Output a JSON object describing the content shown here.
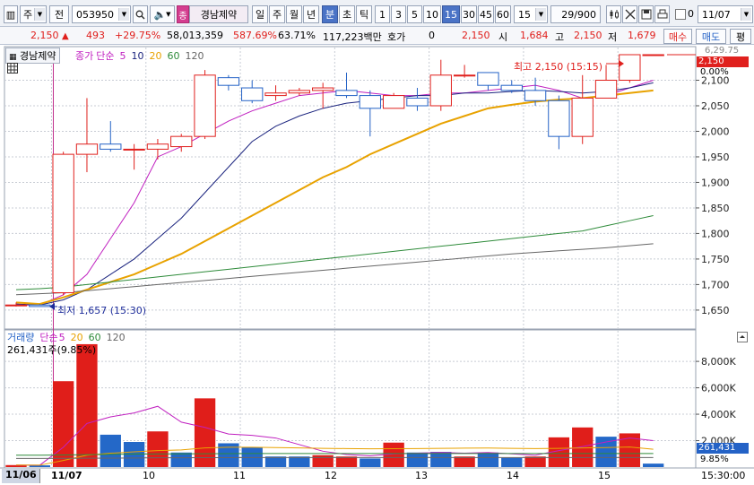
{
  "toolbar": {
    "market": "주",
    "all_label": "전",
    "code": "053950",
    "name_badge": "종",
    "stock_name": "경남제약",
    "periods": [
      "일",
      "주",
      "월",
      "년",
      "분",
      "초",
      "틱"
    ],
    "selected_period": "분",
    "intervals": [
      "1",
      "3",
      "5",
      "10",
      "15",
      "30",
      "45",
      "60"
    ],
    "selected_interval": "15",
    "interval_value": "15",
    "count": "29/900",
    "checkbox_value": "0",
    "date": "11/07"
  },
  "quote": {
    "price": "2,150",
    "change": "493",
    "change_rate": "+29.75%",
    "volume": "58,013,359",
    "volume_ratio": "587.69%",
    "turnover_rate": "63.71%",
    "amount": "117,223백만",
    "bid_label": "호가",
    "bid_value": "0",
    "bid_price": "2,150",
    "open_label": "시",
    "open": "1,684",
    "high_label": "고",
    "high": "2,150",
    "low_label": "저",
    "low": "1,679",
    "buy_label": "매수",
    "sell_label": "매도",
    "eval_label": "평"
  },
  "colors": {
    "up": "#e0201d",
    "down": "#2462c6",
    "ma5": "#c020c0",
    "ma10": "#1a237e",
    "ma20": "#e8a200",
    "ma60": "#2e8b3a",
    "ma120": "#666666"
  },
  "price_panel": {
    "stock_label": "경남제약",
    "legend": {
      "series": "종가",
      "ma_type": "단순",
      "periods": [
        "5",
        "10",
        "20",
        "60",
        "120"
      ]
    },
    "top_label": "6,29.75",
    "top_pct": "0.00%",
    "current_tag": "2,150",
    "high_annotation": "최고 2,150 (15:15)",
    "low_annotation": "최저 1,657 (15:30)"
  },
  "volume_panel": {
    "legend": {
      "series": "거래량",
      "ma_type": "단순",
      "periods": [
        "5",
        "20",
        "60",
        "120"
      ]
    },
    "value_label": "261,431주(9.85%)",
    "current_tag": "261,431",
    "current_pct": "9.85%"
  },
  "x_axis": {
    "labels": [
      "11/06",
      "11/07",
      "10",
      "11",
      "12",
      "13",
      "14",
      "15"
    ],
    "time": "15:30:00"
  },
  "chart_data": [
    {
      "type": "candlestick",
      "ylim": [
        1620,
        2150
      ],
      "yticks": [
        "1,650",
        "1,700",
        "1,750",
        "1,800",
        "1,850",
        "1,900",
        "1,950",
        "2,000",
        "2,050",
        "2,100"
      ],
      "candles": [
        {
          "o": 1660,
          "h": 1665,
          "l": 1657,
          "c": 1660
        },
        {
          "o": 1660,
          "h": 1662,
          "l": 1657,
          "c": 1657
        },
        {
          "o": 1684,
          "h": 1960,
          "l": 1679,
          "c": 1955
        },
        {
          "o": 1955,
          "h": 2065,
          "l": 1920,
          "c": 1975
        },
        {
          "o": 1975,
          "h": 2020,
          "l": 1960,
          "c": 1965
        },
        {
          "o": 1965,
          "h": 1975,
          "l": 1925,
          "c": 1965
        },
        {
          "o": 1965,
          "h": 1985,
          "l": 1945,
          "c": 1975
        },
        {
          "o": 1970,
          "h": 1995,
          "l": 1960,
          "c": 1990
        },
        {
          "o": 1990,
          "h": 2120,
          "l": 1985,
          "c": 2110
        },
        {
          "o": 2105,
          "h": 2110,
          "l": 2080,
          "c": 2090
        },
        {
          "o": 2085,
          "h": 2100,
          "l": 2055,
          "c": 2060
        },
        {
          "o": 2070,
          "h": 2090,
          "l": 2060,
          "c": 2075
        },
        {
          "o": 2075,
          "h": 2085,
          "l": 2070,
          "c": 2080
        },
        {
          "o": 2080,
          "h": 2095,
          "l": 2045,
          "c": 2085
        },
        {
          "o": 2080,
          "h": 2115,
          "l": 2065,
          "c": 2070
        },
        {
          "o": 2070,
          "h": 2080,
          "l": 1990,
          "c": 2045
        },
        {
          "o": 2045,
          "h": 2075,
          "l": 2045,
          "c": 2070
        },
        {
          "o": 2065,
          "h": 2085,
          "l": 2040,
          "c": 2050
        },
        {
          "o": 2050,
          "h": 2140,
          "l": 2040,
          "c": 2110
        },
        {
          "o": 2110,
          "h": 2130,
          "l": 2105,
          "c": 2110
        },
        {
          "o": 2115,
          "h": 2115,
          "l": 2080,
          "c": 2090
        },
        {
          "o": 2090,
          "h": 2100,
          "l": 2075,
          "c": 2080
        },
        {
          "o": 2080,
          "h": 2105,
          "l": 2050,
          "c": 2060
        },
        {
          "o": 2060,
          "h": 2070,
          "l": 1965,
          "c": 1990
        },
        {
          "o": 1990,
          "h": 2110,
          "l": 1975,
          "c": 2065
        },
        {
          "o": 2065,
          "h": 2130,
          "l": 2065,
          "c": 2100
        },
        {
          "o": 2100,
          "h": 2150,
          "l": 2095,
          "c": 2150
        },
        {
          "o": 2150,
          "h": 2150,
          "l": 2150,
          "c": 2150
        }
      ],
      "series": [
        {
          "name": "5",
          "values": [
            1660,
            1660,
            1680,
            1720,
            1790,
            1860,
            1950,
            1970,
            1995,
            2020,
            2040,
            2055,
            2070,
            2075,
            2080,
            2075,
            2070,
            2070,
            2075,
            2075,
            2080,
            2085,
            2090,
            2080,
            2065,
            2070,
            2085,
            2100
          ]
        },
        {
          "name": "10",
          "values": [
            1662,
            1660,
            1670,
            1690,
            1720,
            1750,
            1790,
            1830,
            1880,
            1930,
            1980,
            2010,
            2030,
            2045,
            2055,
            2060,
            2065,
            2070,
            2070,
            2075,
            2075,
            2078,
            2080,
            2078,
            2075,
            2078,
            2085,
            2095
          ]
        },
        {
          "name": "20",
          "values": [
            1665,
            1662,
            1675,
            1690,
            1705,
            1720,
            1740,
            1760,
            1785,
            1810,
            1835,
            1860,
            1885,
            1910,
            1930,
            1955,
            1975,
            1995,
            2015,
            2030,
            2045,
            2052,
            2058,
            2062,
            2065,
            2070,
            2075,
            2080
          ]
        },
        {
          "name": "60",
          "values": [
            1690,
            1692,
            1695,
            1700,
            1705,
            1710,
            1715,
            1720,
            1725,
            1730,
            1735,
            1740,
            1745,
            1750,
            1755,
            1760,
            1765,
            1770,
            1775,
            1780,
            1785,
            1790,
            1795,
            1800,
            1805,
            1815,
            1825,
            1835
          ]
        },
        {
          "name": "120",
          "values": [
            1680,
            1682,
            1684,
            1688,
            1692,
            1696,
            1700,
            1704,
            1708,
            1712,
            1716,
            1720,
            1724,
            1728,
            1732,
            1736,
            1740,
            1744,
            1748,
            1752,
            1756,
            1760,
            1763,
            1766,
            1769,
            1772,
            1776,
            1780
          ]
        }
      ]
    },
    {
      "type": "bar",
      "ylim": [
        0,
        9500
      ],
      "yticks": [
        "2,000K",
        "4,000K",
        "6,000K",
        "8,000K"
      ],
      "values": [
        150,
        130,
        6500,
        9300,
        2450,
        1900,
        2700,
        1100,
        5200,
        1800,
        1500,
        800,
        800,
        900,
        800,
        650,
        1850,
        1100,
        1150,
        800,
        1100,
        700,
        800,
        2250,
        3000,
        2300,
        2550,
        261
      ],
      "directions": [
        "up",
        "down",
        "up",
        "up",
        "down",
        "down",
        "up",
        "down",
        "up",
        "down",
        "down",
        "down",
        "down",
        "up",
        "up",
        "down",
        "up",
        "down",
        "down",
        "up",
        "down",
        "down",
        "up",
        "up",
        "up",
        "down",
        "up",
        "down"
      ],
      "series": [
        {
          "name": "5",
          "values": [
            150,
            140,
            1500,
            3300,
            3800,
            4100,
            4600,
            3400,
            3000,
            2500,
            2400,
            2200,
            1700,
            1200,
            950,
            850,
            1000,
            1050,
            1100,
            1050,
            1100,
            1000,
            900,
            1250,
            1550,
            1900,
            2200,
            2000
          ]
        },
        {
          "name": "20",
          "values": [
            150,
            140,
            500,
            900,
            1050,
            1150,
            1250,
            1300,
            1450,
            1500,
            1500,
            1480,
            1450,
            1420,
            1400,
            1380,
            1390,
            1400,
            1420,
            1430,
            1440,
            1420,
            1400,
            1420,
            1450,
            1480,
            1520,
            1350
          ]
        },
        {
          "name": "60",
          "values": [
            900,
            900,
            920,
            940,
            960,
            980,
            990,
            1000,
            1010,
            1020,
            1030,
            1030,
            1030,
            1030,
            1030,
            1030,
            1030,
            1030,
            1030,
            1030,
            1030,
            1030,
            1030,
            1030,
            1030,
            1030,
            1030,
            1030
          ]
        },
        {
          "name": "120",
          "values": [
            650,
            650,
            660,
            670,
            680,
            690,
            700,
            705,
            710,
            715,
            720,
            720,
            720,
            720,
            720,
            720,
            720,
            720,
            720,
            720,
            720,
            720,
            720,
            720,
            720,
            720,
            720,
            720
          ]
        }
      ]
    }
  ]
}
